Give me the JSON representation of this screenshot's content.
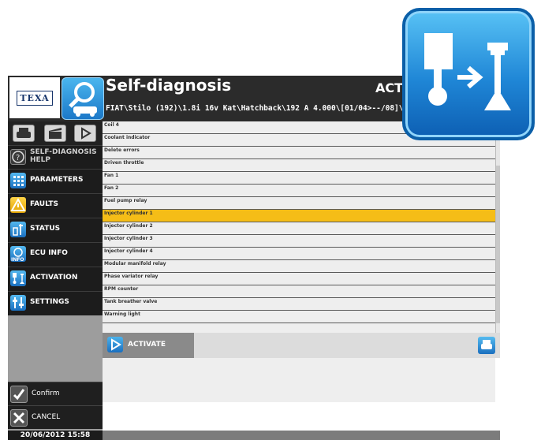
{
  "brand": {
    "logo_text": "TEXA"
  },
  "header": {
    "title": "Self-diagnosis",
    "mode": "ACT",
    "vehicle_path": "FIAT\\Stilo (192)\\1.8i 16v Kat\\Hatchback\\192 A 4.000\\[01/04>--/08]\\Petrol in"
  },
  "sidebar": {
    "help_label_1": "SELF-DIAGNOSIS",
    "help_label_2": "HELP",
    "items": [
      {
        "label": "PARAMETERS",
        "icon": "parameters-icon"
      },
      {
        "label": "FAULTS",
        "icon": "warning-icon"
      },
      {
        "label": "STATUS",
        "icon": "status-icon"
      },
      {
        "label": "ECU INFO",
        "icon": "info-icon"
      },
      {
        "label": "ACTIVATION",
        "icon": "activation-icon"
      },
      {
        "label": "SETTINGS",
        "icon": "settings-icon"
      }
    ],
    "confirm_label": "Confirm",
    "cancel_label": "CANCEL",
    "datetime": "20/06/2012 15:58"
  },
  "list": {
    "items": [
      "Coil 4",
      "Coolant indicator",
      "Delete errors",
      "Driven throttle",
      "Fan 1",
      "Fan 2",
      "Fuel pump relay",
      "Injector cylinder 1",
      "Injector cylinder 2",
      "Injector cylinder 3",
      "Injector cylinder 4",
      "Modular manifold relay",
      "Phase variator relay",
      "RPM counter",
      "Tank breather valve",
      "Warning light"
    ],
    "selected_index": 7
  },
  "actions": {
    "activate_label": "ACTIVATE"
  },
  "colors": {
    "selected": "#f5bd17",
    "accent": "#1f86d6",
    "dark": "#1c1c1c"
  }
}
